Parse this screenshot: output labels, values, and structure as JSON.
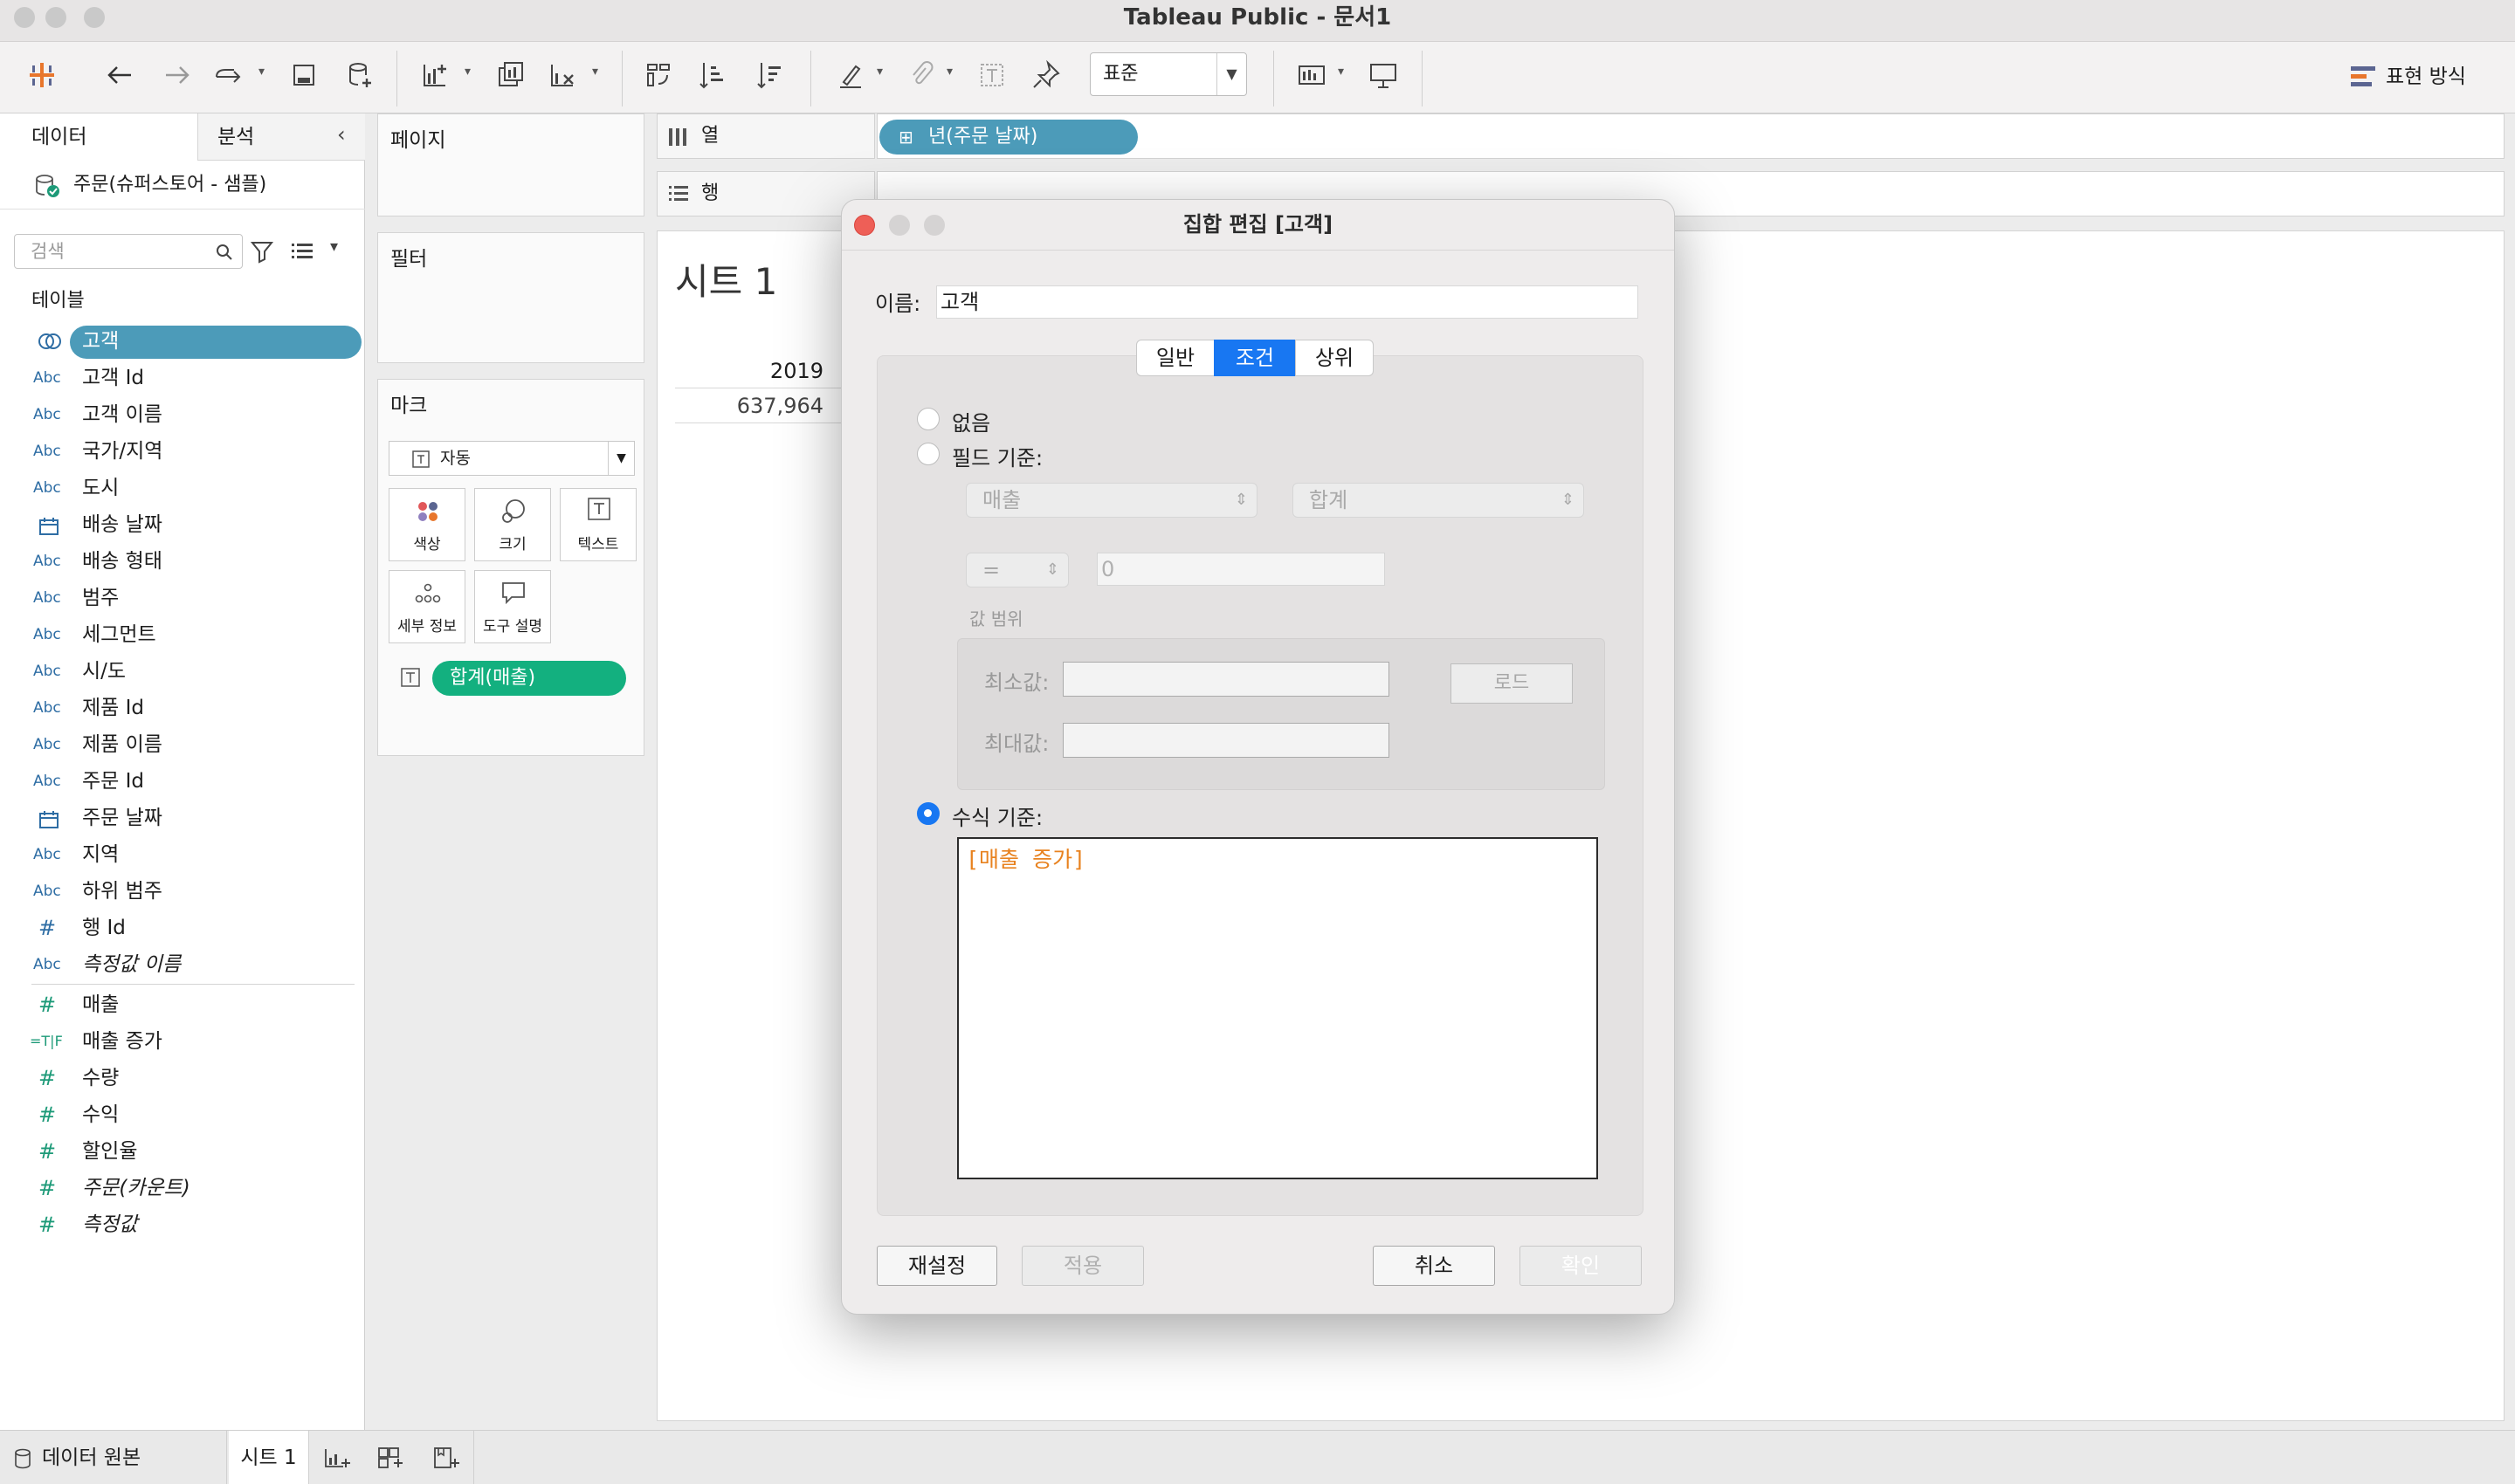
{
  "app": {
    "title": "Tableau Public - 문서1"
  },
  "toolbar": {
    "standard_select": "표준",
    "show_me_label": "표현 방식"
  },
  "data_pane": {
    "tab_data": "데이터",
    "tab_analysis": "분석",
    "datasource": "주문(슈퍼스토어 - 샘플)",
    "search_placeholder": "검색",
    "tables_header": "테이블",
    "fields": [
      {
        "icon": "set",
        "label": "고객",
        "selected": true
      },
      {
        "icon": "Abc",
        "label": "고객 Id"
      },
      {
        "icon": "Abc",
        "label": "고객 이름"
      },
      {
        "icon": "Abc",
        "label": "국가/지역"
      },
      {
        "icon": "Abc",
        "label": "도시"
      },
      {
        "icon": "date",
        "label": "배송 날짜"
      },
      {
        "icon": "Abc",
        "label": "배송 형태"
      },
      {
        "icon": "Abc",
        "label": "범주"
      },
      {
        "icon": "Abc",
        "label": "세그먼트"
      },
      {
        "icon": "Abc",
        "label": "시/도"
      },
      {
        "icon": "Abc",
        "label": "제품 Id"
      },
      {
        "icon": "Abc",
        "label": "제품 이름"
      },
      {
        "icon": "Abc",
        "label": "주문 Id"
      },
      {
        "icon": "date",
        "label": "주문 날짜"
      },
      {
        "icon": "Abc",
        "label": "지역"
      },
      {
        "icon": "Abc",
        "label": "하위 범주"
      },
      {
        "icon": "#",
        "label": "행 Id"
      },
      {
        "icon": "Abc",
        "label": "측정값 이름",
        "italic": true
      },
      {
        "icon": "#",
        "label": "매출"
      },
      {
        "icon": "=T|F",
        "label": "매출 증가"
      },
      {
        "icon": "#",
        "label": "수량"
      },
      {
        "icon": "#",
        "label": "수익"
      },
      {
        "icon": "#",
        "label": "할인율"
      },
      {
        "icon": "#",
        "label": "주문(카운트)",
        "italic": true
      },
      {
        "icon": "#",
        "label": "측정값",
        "italic": true
      }
    ]
  },
  "shelves": {
    "pages": "페이지",
    "filters": "필터",
    "marks": "마크",
    "mark_type": "자동",
    "mark_buttons": [
      "색상",
      "크기",
      "텍스트",
      "세부 정보",
      "도구 설명"
    ],
    "mark_pill": "합계(매출)",
    "columns_label": "열",
    "rows_label": "행",
    "columns_pill": "년(주문 날짜)"
  },
  "sheet": {
    "title": "시트 1",
    "year_header": "2019",
    "value": "637,964"
  },
  "dialog": {
    "title": "집합 편집 [고객]",
    "name_label": "이름:",
    "name_value": "고객",
    "tabs": [
      "일반",
      "조건",
      "상위"
    ],
    "active_tab": "조건",
    "none_label": "없음",
    "by_field_label": "필드 기준:",
    "field_select": "매출",
    "agg_select": "합계",
    "op_select": "=",
    "value_input": "0",
    "range_label": "값 범위",
    "min_label": "최소값:",
    "max_label": "최대값:",
    "load_button": "로드",
    "by_formula_label": "수식 기준:",
    "formula": "[매출 증가]",
    "reset_button": "재설정",
    "apply_button": "적용",
    "cancel_button": "취소",
    "ok_button": "확인"
  },
  "bottom": {
    "datasource_tab": "데이터 원본",
    "sheet_tab": "시트 1"
  },
  "colors": {
    "accent_blue": "#1877f2",
    "pill_blue": "#4c9bb9",
    "pill_green": "#13b07f",
    "formula_orange": "#e8821f"
  }
}
